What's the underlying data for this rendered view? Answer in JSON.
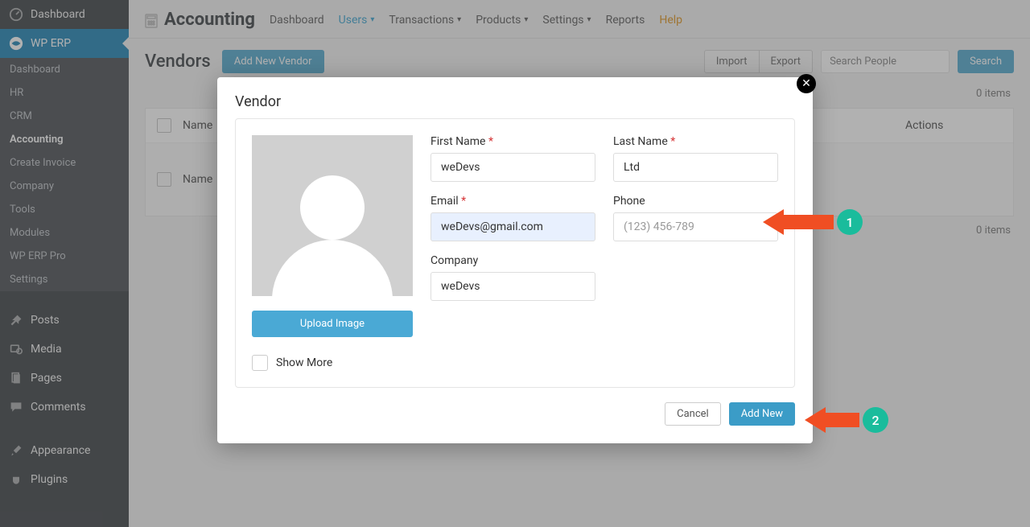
{
  "sidebar": {
    "dashboard": "Dashboard",
    "wp_erp": "WP ERP",
    "sub": [
      "Dashboard",
      "HR",
      "CRM",
      "Accounting",
      "Create Invoice",
      "Company",
      "Tools",
      "Modules",
      "WP ERP Pro",
      "Settings"
    ],
    "posts": "Posts",
    "media": "Media",
    "pages": "Pages",
    "comments": "Comments",
    "appearance": "Appearance",
    "plugins": "Plugins"
  },
  "topbar": {
    "title": "Accounting",
    "items": [
      "Dashboard",
      "Users",
      "Transactions",
      "Products",
      "Settings",
      "Reports",
      "Help"
    ]
  },
  "page": {
    "title": "Vendors",
    "add_btn": "Add New Vendor",
    "import": "Import",
    "export": "Export",
    "search_placeholder": "Search People",
    "search_btn": "Search",
    "items_count": "0 items",
    "col_name": "Name",
    "col_actions": "Actions"
  },
  "modal": {
    "title": "Vendor",
    "upload": "Upload Image",
    "show_more": "Show More",
    "first_name_label": "First Name",
    "first_name": "weDevs",
    "last_name_label": "Last Name",
    "last_name": "Ltd",
    "email_label": "Email",
    "email": "weDevs@gmail.com",
    "phone_label": "Phone",
    "phone_placeholder": "(123) 456-789",
    "company_label": "Company",
    "company": "weDevs",
    "cancel": "Cancel",
    "add_new": "Add New"
  },
  "anno": {
    "one": "1",
    "two": "2"
  }
}
